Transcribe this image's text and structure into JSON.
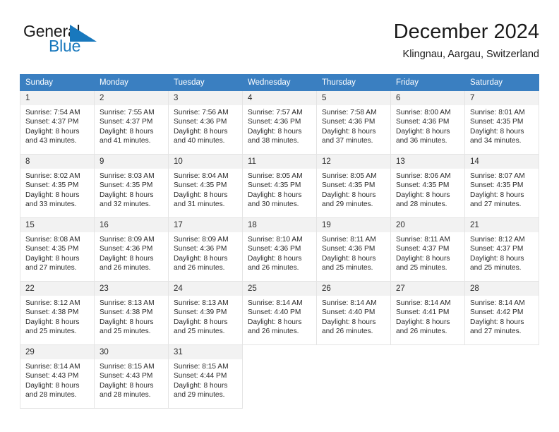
{
  "brand": {
    "name_part1": "General",
    "name_part2": "Blue",
    "flag_icon": "flag-triangle-icon",
    "accent_color": "#1878bd"
  },
  "header": {
    "title": "December 2024",
    "subtitle": "Klingnau, Aargau, Switzerland"
  },
  "calendar": {
    "header_bg": "#3a7fc1",
    "daynum_bg": "#f2f2f2",
    "weekdays": [
      "Sunday",
      "Monday",
      "Tuesday",
      "Wednesday",
      "Thursday",
      "Friday",
      "Saturday"
    ],
    "weeks": [
      [
        {
          "day": "1",
          "sunrise": "Sunrise: 7:54 AM",
          "sunset": "Sunset: 4:37 PM",
          "daylight_line1": "Daylight: 8 hours",
          "daylight_line2": "and 43 minutes."
        },
        {
          "day": "2",
          "sunrise": "Sunrise: 7:55 AM",
          "sunset": "Sunset: 4:37 PM",
          "daylight_line1": "Daylight: 8 hours",
          "daylight_line2": "and 41 minutes."
        },
        {
          "day": "3",
          "sunrise": "Sunrise: 7:56 AM",
          "sunset": "Sunset: 4:36 PM",
          "daylight_line1": "Daylight: 8 hours",
          "daylight_line2": "and 40 minutes."
        },
        {
          "day": "4",
          "sunrise": "Sunrise: 7:57 AM",
          "sunset": "Sunset: 4:36 PM",
          "daylight_line1": "Daylight: 8 hours",
          "daylight_line2": "and 38 minutes."
        },
        {
          "day": "5",
          "sunrise": "Sunrise: 7:58 AM",
          "sunset": "Sunset: 4:36 PM",
          "daylight_line1": "Daylight: 8 hours",
          "daylight_line2": "and 37 minutes."
        },
        {
          "day": "6",
          "sunrise": "Sunrise: 8:00 AM",
          "sunset": "Sunset: 4:36 PM",
          "daylight_line1": "Daylight: 8 hours",
          "daylight_line2": "and 36 minutes."
        },
        {
          "day": "7",
          "sunrise": "Sunrise: 8:01 AM",
          "sunset": "Sunset: 4:35 PM",
          "daylight_line1": "Daylight: 8 hours",
          "daylight_line2": "and 34 minutes."
        }
      ],
      [
        {
          "day": "8",
          "sunrise": "Sunrise: 8:02 AM",
          "sunset": "Sunset: 4:35 PM",
          "daylight_line1": "Daylight: 8 hours",
          "daylight_line2": "and 33 minutes."
        },
        {
          "day": "9",
          "sunrise": "Sunrise: 8:03 AM",
          "sunset": "Sunset: 4:35 PM",
          "daylight_line1": "Daylight: 8 hours",
          "daylight_line2": "and 32 minutes."
        },
        {
          "day": "10",
          "sunrise": "Sunrise: 8:04 AM",
          "sunset": "Sunset: 4:35 PM",
          "daylight_line1": "Daylight: 8 hours",
          "daylight_line2": "and 31 minutes."
        },
        {
          "day": "11",
          "sunrise": "Sunrise: 8:05 AM",
          "sunset": "Sunset: 4:35 PM",
          "daylight_line1": "Daylight: 8 hours",
          "daylight_line2": "and 30 minutes."
        },
        {
          "day": "12",
          "sunrise": "Sunrise: 8:05 AM",
          "sunset": "Sunset: 4:35 PM",
          "daylight_line1": "Daylight: 8 hours",
          "daylight_line2": "and 29 minutes."
        },
        {
          "day": "13",
          "sunrise": "Sunrise: 8:06 AM",
          "sunset": "Sunset: 4:35 PM",
          "daylight_line1": "Daylight: 8 hours",
          "daylight_line2": "and 28 minutes."
        },
        {
          "day": "14",
          "sunrise": "Sunrise: 8:07 AM",
          "sunset": "Sunset: 4:35 PM",
          "daylight_line1": "Daylight: 8 hours",
          "daylight_line2": "and 27 minutes."
        }
      ],
      [
        {
          "day": "15",
          "sunrise": "Sunrise: 8:08 AM",
          "sunset": "Sunset: 4:35 PM",
          "daylight_line1": "Daylight: 8 hours",
          "daylight_line2": "and 27 minutes."
        },
        {
          "day": "16",
          "sunrise": "Sunrise: 8:09 AM",
          "sunset": "Sunset: 4:36 PM",
          "daylight_line1": "Daylight: 8 hours",
          "daylight_line2": "and 26 minutes."
        },
        {
          "day": "17",
          "sunrise": "Sunrise: 8:09 AM",
          "sunset": "Sunset: 4:36 PM",
          "daylight_line1": "Daylight: 8 hours",
          "daylight_line2": "and 26 minutes."
        },
        {
          "day": "18",
          "sunrise": "Sunrise: 8:10 AM",
          "sunset": "Sunset: 4:36 PM",
          "daylight_line1": "Daylight: 8 hours",
          "daylight_line2": "and 26 minutes."
        },
        {
          "day": "19",
          "sunrise": "Sunrise: 8:11 AM",
          "sunset": "Sunset: 4:36 PM",
          "daylight_line1": "Daylight: 8 hours",
          "daylight_line2": "and 25 minutes."
        },
        {
          "day": "20",
          "sunrise": "Sunrise: 8:11 AM",
          "sunset": "Sunset: 4:37 PM",
          "daylight_line1": "Daylight: 8 hours",
          "daylight_line2": "and 25 minutes."
        },
        {
          "day": "21",
          "sunrise": "Sunrise: 8:12 AM",
          "sunset": "Sunset: 4:37 PM",
          "daylight_line1": "Daylight: 8 hours",
          "daylight_line2": "and 25 minutes."
        }
      ],
      [
        {
          "day": "22",
          "sunrise": "Sunrise: 8:12 AM",
          "sunset": "Sunset: 4:38 PM",
          "daylight_line1": "Daylight: 8 hours",
          "daylight_line2": "and 25 minutes."
        },
        {
          "day": "23",
          "sunrise": "Sunrise: 8:13 AM",
          "sunset": "Sunset: 4:38 PM",
          "daylight_line1": "Daylight: 8 hours",
          "daylight_line2": "and 25 minutes."
        },
        {
          "day": "24",
          "sunrise": "Sunrise: 8:13 AM",
          "sunset": "Sunset: 4:39 PM",
          "daylight_line1": "Daylight: 8 hours",
          "daylight_line2": "and 25 minutes."
        },
        {
          "day": "25",
          "sunrise": "Sunrise: 8:14 AM",
          "sunset": "Sunset: 4:40 PM",
          "daylight_line1": "Daylight: 8 hours",
          "daylight_line2": "and 26 minutes."
        },
        {
          "day": "26",
          "sunrise": "Sunrise: 8:14 AM",
          "sunset": "Sunset: 4:40 PM",
          "daylight_line1": "Daylight: 8 hours",
          "daylight_line2": "and 26 minutes."
        },
        {
          "day": "27",
          "sunrise": "Sunrise: 8:14 AM",
          "sunset": "Sunset: 4:41 PM",
          "daylight_line1": "Daylight: 8 hours",
          "daylight_line2": "and 26 minutes."
        },
        {
          "day": "28",
          "sunrise": "Sunrise: 8:14 AM",
          "sunset": "Sunset: 4:42 PM",
          "daylight_line1": "Daylight: 8 hours",
          "daylight_line2": "and 27 minutes."
        }
      ],
      [
        {
          "day": "29",
          "sunrise": "Sunrise: 8:14 AM",
          "sunset": "Sunset: 4:43 PM",
          "daylight_line1": "Daylight: 8 hours",
          "daylight_line2": "and 28 minutes."
        },
        {
          "day": "30",
          "sunrise": "Sunrise: 8:15 AM",
          "sunset": "Sunset: 4:43 PM",
          "daylight_line1": "Daylight: 8 hours",
          "daylight_line2": "and 28 minutes."
        },
        {
          "day": "31",
          "sunrise": "Sunrise: 8:15 AM",
          "sunset": "Sunset: 4:44 PM",
          "daylight_line1": "Daylight: 8 hours",
          "daylight_line2": "and 29 minutes."
        },
        {
          "day": "",
          "sunrise": "",
          "sunset": "",
          "daylight_line1": "",
          "daylight_line2": ""
        },
        {
          "day": "",
          "sunrise": "",
          "sunset": "",
          "daylight_line1": "",
          "daylight_line2": ""
        },
        {
          "day": "",
          "sunrise": "",
          "sunset": "",
          "daylight_line1": "",
          "daylight_line2": ""
        },
        {
          "day": "",
          "sunrise": "",
          "sunset": "",
          "daylight_line1": "",
          "daylight_line2": ""
        }
      ]
    ]
  }
}
